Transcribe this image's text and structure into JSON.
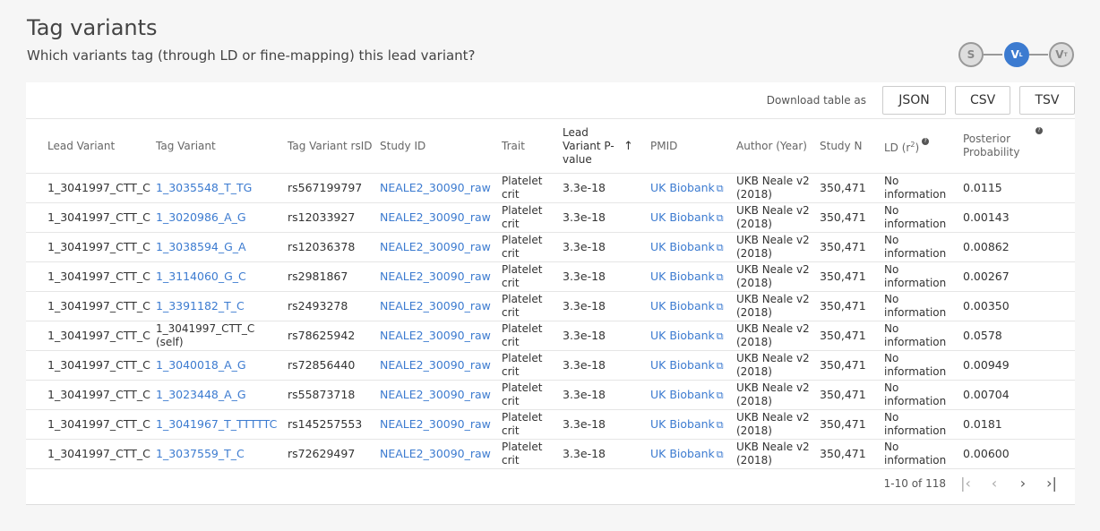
{
  "header": {
    "title": "Tag variants",
    "subtitle": "Which variants tag (through LD or fine-mapping) this lead variant?"
  },
  "stepper": {
    "steps": [
      {
        "letter": "S",
        "sub": ""
      },
      {
        "letter": "V",
        "sub": "L"
      },
      {
        "letter": "V",
        "sub": "T"
      }
    ]
  },
  "download": {
    "label": "Download table as",
    "json": "JSON",
    "csv": "CSV",
    "tsv": "TSV"
  },
  "columns": {
    "lead_variant": "Lead Variant",
    "tag_variant": "Tag Variant",
    "tag_rsid": "Tag Variant rsID",
    "study_id": "Study ID",
    "trait": "Trait",
    "lead_pvalue": "Lead Variant P-value",
    "pmid": "PMID",
    "author": "Author (Year)",
    "study_n": "Study N",
    "ld": "LD (r",
    "ld_sup": "2",
    "ld_close": ")",
    "posterior": "Posterior Probability"
  },
  "rows": [
    {
      "lead": "1_3041997_CTT_C",
      "tag": "1_3035548_T_TG",
      "tag_link": true,
      "rsid": "rs567199797",
      "study": "NEALE2_30090_raw",
      "trait": "Platelet crit",
      "pval": "3.3e-18",
      "pmid": "UK Biobank",
      "author": "UKB Neale v2 (2018)",
      "n": "350,471",
      "ld": "No information",
      "pp": "0.0115"
    },
    {
      "lead": "1_3041997_CTT_C",
      "tag": "1_3020986_A_G",
      "tag_link": true,
      "rsid": "rs12033927",
      "study": "NEALE2_30090_raw",
      "trait": "Platelet crit",
      "pval": "3.3e-18",
      "pmid": "UK Biobank",
      "author": "UKB Neale v2 (2018)",
      "n": "350,471",
      "ld": "No information",
      "pp": "0.00143"
    },
    {
      "lead": "1_3041997_CTT_C",
      "tag": "1_3038594_G_A",
      "tag_link": true,
      "rsid": "rs12036378",
      "study": "NEALE2_30090_raw",
      "trait": "Platelet crit",
      "pval": "3.3e-18",
      "pmid": "UK Biobank",
      "author": "UKB Neale v2 (2018)",
      "n": "350,471",
      "ld": "No information",
      "pp": "0.00862"
    },
    {
      "lead": "1_3041997_CTT_C",
      "tag": "1_3114060_G_C",
      "tag_link": true,
      "rsid": "rs2981867",
      "study": "NEALE2_30090_raw",
      "trait": "Platelet crit",
      "pval": "3.3e-18",
      "pmid": "UK Biobank",
      "author": "UKB Neale v2 (2018)",
      "n": "350,471",
      "ld": "No information",
      "pp": "0.00267"
    },
    {
      "lead": "1_3041997_CTT_C",
      "tag": "1_3391182_T_C",
      "tag_link": true,
      "rsid": "rs2493278",
      "study": "NEALE2_30090_raw",
      "trait": "Platelet crit",
      "pval": "3.3e-18",
      "pmid": "UK Biobank",
      "author": "UKB Neale v2 (2018)",
      "n": "350,471",
      "ld": "No information",
      "pp": "0.00350"
    },
    {
      "lead": "1_3041997_CTT_C",
      "tag": "1_3041997_CTT_C (self)",
      "tag_link": false,
      "rsid": "rs78625942",
      "study": "NEALE2_30090_raw",
      "trait": "Platelet crit",
      "pval": "3.3e-18",
      "pmid": "UK Biobank",
      "author": "UKB Neale v2 (2018)",
      "n": "350,471",
      "ld": "No information",
      "pp": "0.0578"
    },
    {
      "lead": "1_3041997_CTT_C",
      "tag": "1_3040018_A_G",
      "tag_link": true,
      "rsid": "rs72856440",
      "study": "NEALE2_30090_raw",
      "trait": "Platelet crit",
      "pval": "3.3e-18",
      "pmid": "UK Biobank",
      "author": "UKB Neale v2 (2018)",
      "n": "350,471",
      "ld": "No information",
      "pp": "0.00949"
    },
    {
      "lead": "1_3041997_CTT_C",
      "tag": "1_3023448_A_G",
      "tag_link": true,
      "rsid": "rs55873718",
      "study": "NEALE2_30090_raw",
      "trait": "Platelet crit",
      "pval": "3.3e-18",
      "pmid": "UK Biobank",
      "author": "UKB Neale v2 (2018)",
      "n": "350,471",
      "ld": "No information",
      "pp": "0.00704"
    },
    {
      "lead": "1_3041997_CTT_C",
      "tag": "1_3041967_T_TTTTTC",
      "tag_link": true,
      "rsid": "rs145257553",
      "study": "NEALE2_30090_raw",
      "trait": "Platelet crit",
      "pval": "3.3e-18",
      "pmid": "UK Biobank",
      "author": "UKB Neale v2 (2018)",
      "n": "350,471",
      "ld": "No information",
      "pp": "0.0181"
    },
    {
      "lead": "1_3041997_CTT_C",
      "tag": "1_3037559_T_C",
      "tag_link": true,
      "rsid": "rs72629497",
      "study": "NEALE2_30090_raw",
      "trait": "Platelet crit",
      "pval": "3.3e-18",
      "pmid": "UK Biobank",
      "author": "UKB Neale v2 (2018)",
      "n": "350,471",
      "ld": "No information",
      "pp": "0.00600"
    }
  ],
  "pagination": {
    "range": "1-10 of 118",
    "first_icon": "first-page-icon",
    "prev_icon": "chevron-left-icon",
    "next_icon": "chevron-right-icon",
    "last_icon": "last-page-icon"
  },
  "colors": {
    "link": "#3c7bd0",
    "active_step": "#3c7bd0"
  }
}
